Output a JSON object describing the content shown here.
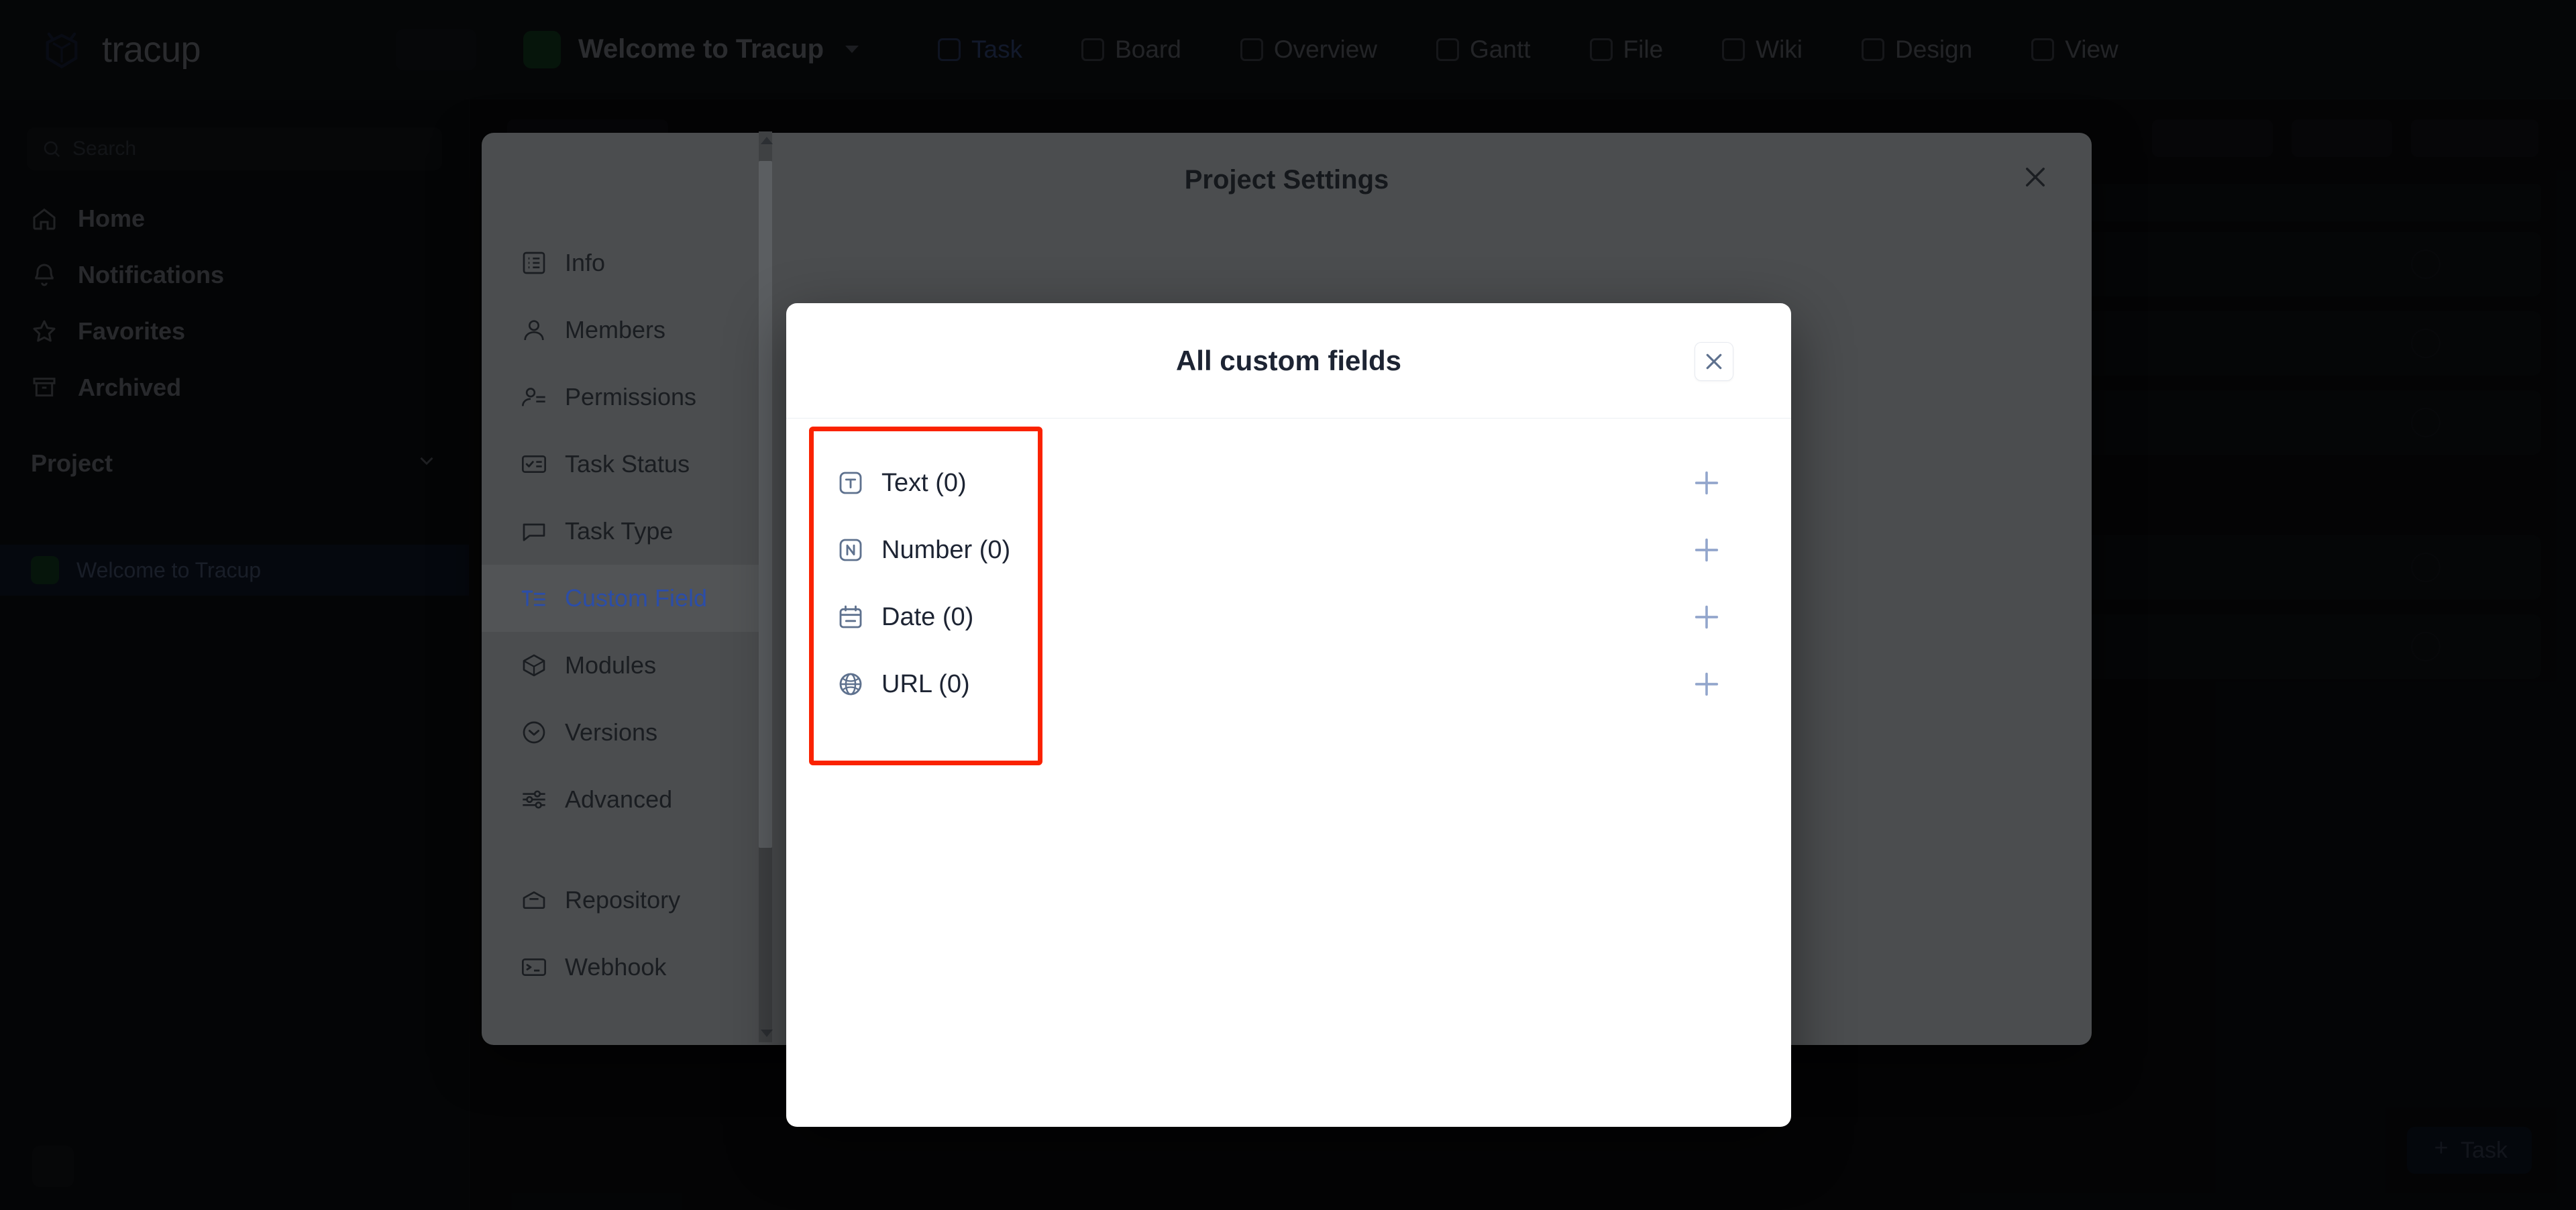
{
  "app": {
    "brand": "tracup",
    "brand_icon": "tracup-hex-logo-icon"
  },
  "topbar": {
    "project_name": "Welcome to Tracup",
    "project_dropdown_icon": "chevron-down-icon",
    "tabs": [
      {
        "label": "Task",
        "icon": "task-icon",
        "active": true
      },
      {
        "label": "Board",
        "icon": "board-icon",
        "active": false
      },
      {
        "label": "Overview",
        "icon": "overview-icon",
        "active": false
      },
      {
        "label": "Gantt",
        "icon": "gantt-icon",
        "active": false
      },
      {
        "label": "File",
        "icon": "file-icon",
        "active": false
      },
      {
        "label": "Wiki",
        "icon": "wiki-icon",
        "active": false
      },
      {
        "label": "Design",
        "icon": "design-icon",
        "active": false
      },
      {
        "label": "View",
        "icon": "view-icon",
        "active": false
      }
    ]
  },
  "sidebar": {
    "search_placeholder": "Search",
    "items": [
      {
        "label": "Home",
        "icon": "home-icon"
      },
      {
        "label": "Notifications",
        "icon": "bell-icon"
      },
      {
        "label": "Favorites",
        "icon": "star-icon"
      },
      {
        "label": "Archived",
        "icon": "archive-icon"
      }
    ],
    "section": {
      "label": "Project",
      "collapse_icon": "chevron-down-icon"
    },
    "projects": [
      {
        "label": "Welcome to Tracup",
        "selected": true
      }
    ]
  },
  "background_main": {
    "task_fab_label": "Task",
    "task_fab_icon": "plus-icon"
  },
  "settings_panel": {
    "title": "Project Settings",
    "close_icon": "close-icon",
    "nav": [
      {
        "label": "Info",
        "icon": "info-list-icon",
        "active": false
      },
      {
        "label": "Members",
        "icon": "user-icon",
        "active": false
      },
      {
        "label": "Permissions",
        "icon": "user-lines-icon",
        "active": false
      },
      {
        "label": "Task Status",
        "icon": "task-status-icon",
        "active": false
      },
      {
        "label": "Task Type",
        "icon": "task-type-icon",
        "active": false
      },
      {
        "label": "Custom Field",
        "icon": "text-lines-icon",
        "active": true
      },
      {
        "label": "Modules",
        "icon": "cube-icon",
        "active": false
      },
      {
        "label": "Versions",
        "icon": "circle-chevron-down-icon",
        "active": false
      },
      {
        "label": "Advanced",
        "icon": "sliders-icon",
        "active": false
      }
    ],
    "nav_group_two": [
      {
        "label": "Repository",
        "icon": "repository-icon",
        "active": false
      },
      {
        "label": "Webhook",
        "icon": "webhook-terminal-icon",
        "active": false
      }
    ],
    "scrollbar": {
      "up_arrow_icon": "caret-up-icon",
      "down_arrow_icon": "caret-down-icon"
    }
  },
  "custom_fields_modal": {
    "title": "All custom fields",
    "close_icon": "close-icon",
    "rows": [
      {
        "label": "Text (0)",
        "icon": "text-field-icon",
        "add_icon": "plus-icon"
      },
      {
        "label": "Number (0)",
        "icon": "number-field-icon",
        "add_icon": "plus-icon"
      },
      {
        "label": "Date (0)",
        "icon": "calendar-icon",
        "add_icon": "plus-icon"
      },
      {
        "label": "URL (0)",
        "icon": "globe-icon",
        "add_icon": "plus-icon"
      }
    ]
  },
  "annotation": {
    "color": "#fa2200",
    "target": "custom-field-type-list"
  }
}
